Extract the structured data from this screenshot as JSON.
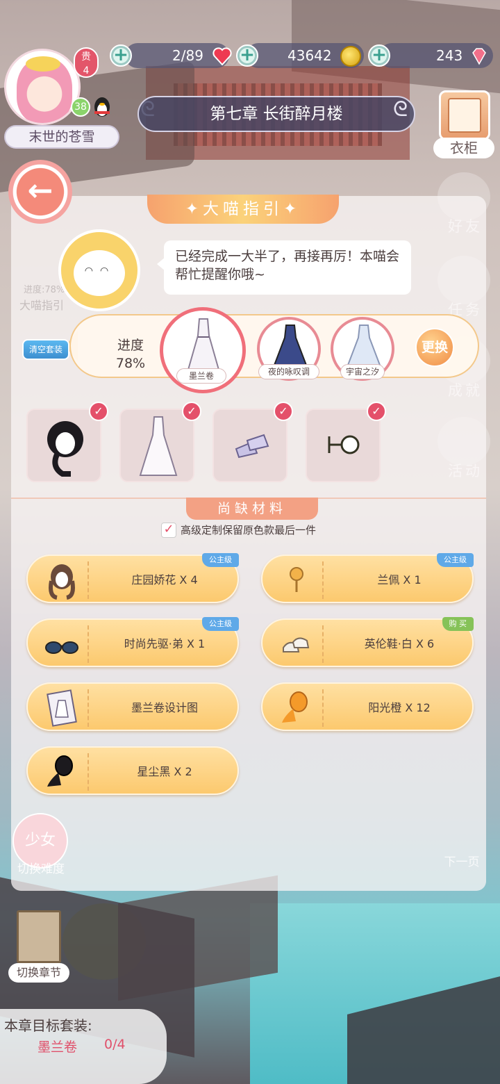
{
  "player": {
    "name": "末世的苍雪",
    "vip_label": "贵",
    "vip_level": "4",
    "level": "38"
  },
  "resources": {
    "stamina": "2/89",
    "coins": "43642",
    "diamonds": "243"
  },
  "chapter_title": "第七章 长街醉月楼",
  "wardrobe_label": "衣柜",
  "side_menu": [
    {
      "label": "好友"
    },
    {
      "label": "任务"
    },
    {
      "label": "成就"
    },
    {
      "label": "活动"
    }
  ],
  "panel": {
    "title": "✦大喵指引✦",
    "guide_text": "已经完成一大半了，再接再厉！本喵会帮忙提醒你哦~",
    "ghost_guide": "大喵指引",
    "ghost_progress": "进度:78%",
    "clear_suit": "清空套装",
    "progress_label": "进度",
    "progress_value": "78%",
    "switch_label": "更换",
    "suits": [
      {
        "name": "墨兰卷"
      },
      {
        "name": "夜的咏叹调"
      },
      {
        "name": "宇宙之汐"
      }
    ],
    "slots": [
      "hair",
      "dress",
      "shoes",
      "accessory"
    ],
    "missing_title": "尚缺材料",
    "keep_label": "高级定制保留原色款最后一件",
    "materials": [
      {
        "label": "庄园娇花 X 4",
        "tag": "公主级"
      },
      {
        "label": "兰佩 X 1",
        "tag": "公主级"
      },
      {
        "label": "时尚先驱·弟 X 1",
        "tag": "公主级"
      },
      {
        "label": "英伦鞋·白 X 6",
        "tag": "购 买"
      },
      {
        "label": "墨兰卷设计图",
        "tag": ""
      },
      {
        "label": "阳光橙 X 12",
        "tag": ""
      },
      {
        "label": "星尘黑 X 2",
        "tag": ""
      }
    ]
  },
  "difficulty": {
    "button": "少女",
    "label": "切换难度"
  },
  "next_page": "下一页",
  "chapter_switch": "切换章节",
  "target": {
    "title": "本章目标套装:",
    "suit": "墨兰卷",
    "count": "0/4"
  },
  "colors": {
    "accent_orange": "#f6a26e",
    "button_yellow": "#fcc96e",
    "highlight_red": "#e0506a",
    "tag_blue": "#5fa9e8",
    "tag_green": "#86c258"
  }
}
